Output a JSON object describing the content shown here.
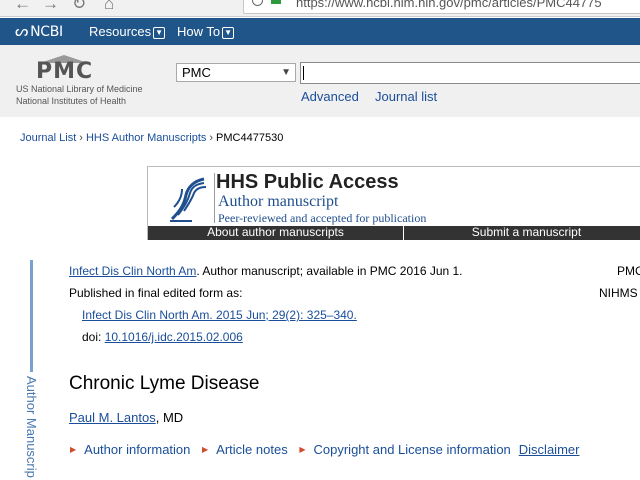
{
  "browser": {
    "url": "https://www.ncbi.nlm.nih.gov/pmc/articles/PMC44775"
  },
  "ncbi_bar": {
    "logo": "NCBI",
    "menus": [
      "Resources",
      "How To"
    ]
  },
  "pmc_header": {
    "logo": "PMC",
    "org_line1": "US National Library of Medicine",
    "org_line2": "National Institutes of Health",
    "db_select": "PMC",
    "search_value": "",
    "links": [
      "Advanced",
      "Journal list"
    ]
  },
  "breadcrumb": {
    "items": [
      "Journal List",
      "HHS Author Manuscripts",
      "PMC4477530"
    ]
  },
  "hhs_banner": {
    "title": "HHS Public Access",
    "subtitle": "Author manuscript",
    "tagline": "Peer-reviewed and accepted for publication",
    "buttons": [
      "About author manuscripts",
      "Submit a manuscript"
    ]
  },
  "side_tab": "Author Manuscrip",
  "citation": {
    "journal_link": "Infect Dis Clin North Am",
    "availability": ". Author manuscript; available in PMC 2016 Jun 1.",
    "published_label": "Published in final edited form as:",
    "final_link": "Infect Dis Clin North Am. 2015 Jun; 29(2): 325–340.",
    "doi_label": "doi: ",
    "doi_link": "10.1016/j.idc.2015.02.006",
    "right_pmc": "PMC",
    "right_nihms": "NIHMS"
  },
  "article": {
    "title": "Chronic Lyme Disease",
    "author_name": "Paul M. Lantos",
    "author_suffix": ", MD"
  },
  "article_tabs": {
    "items": [
      "Author information",
      "Article notes",
      "Copyright and License information"
    ],
    "disclaimer": "Disclaimer"
  }
}
